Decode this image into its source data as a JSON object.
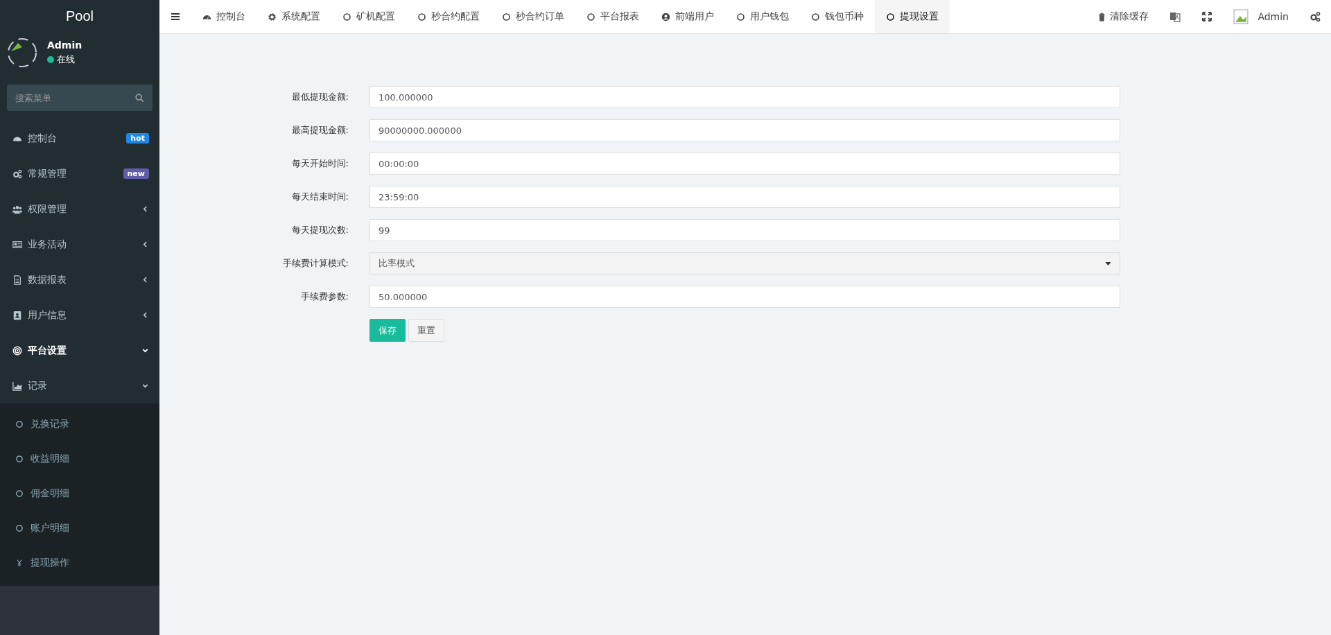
{
  "sidebar": {
    "title": "Pool",
    "user": {
      "name": "Admin",
      "status": "在线"
    },
    "search": {
      "placeholder": "搜索菜单"
    },
    "menu": [
      {
        "label": "控制台",
        "kind": "dashboard",
        "badge": {
          "text": "hot",
          "color": "#1e88e5"
        },
        "selected": false
      },
      {
        "label": "常规管理",
        "kind": "gears",
        "badge": {
          "text": "new",
          "color": "#605ca8"
        },
        "selected": false
      },
      {
        "label": "权限管理",
        "kind": "users",
        "expanded": false,
        "selected": false
      },
      {
        "label": "业务活动",
        "kind": "newspaper",
        "expanded": false,
        "selected": false
      },
      {
        "label": "数据报表",
        "kind": "file",
        "expanded": false,
        "selected": false
      },
      {
        "label": "用户信息",
        "kind": "contact",
        "expanded": false,
        "selected": false
      },
      {
        "label": "平台设置",
        "kind": "target",
        "expanded": true,
        "selected": true
      },
      {
        "label": "记录",
        "kind": "chart",
        "expanded": true,
        "selected": false,
        "children": [
          {
            "label": "兑换记录",
            "kind": "circle"
          },
          {
            "label": "收益明细",
            "kind": "circle"
          },
          {
            "label": "佣金明细",
            "kind": "circle"
          },
          {
            "label": "账户明细",
            "kind": "circle"
          },
          {
            "label": "提现操作",
            "kind": "yen"
          }
        ]
      }
    ]
  },
  "tabs": [
    {
      "label": "控制台",
      "kind": "dashboard",
      "selected": false
    },
    {
      "label": "系统配置",
      "kind": "gear",
      "selected": false
    },
    {
      "label": "矿机配置",
      "kind": "circle",
      "selected": false
    },
    {
      "label": "秒合约配置",
      "kind": "circle",
      "selected": false
    },
    {
      "label": "秒合约订单",
      "kind": "circle",
      "selected": false
    },
    {
      "label": "平台报表",
      "kind": "circle",
      "selected": false
    },
    {
      "label": "前端用户",
      "kind": "user",
      "selected": false
    },
    {
      "label": "用户钱包",
      "kind": "circle",
      "selected": false
    },
    {
      "label": "钱包币种",
      "kind": "circle",
      "selected": false
    },
    {
      "label": "提现设置",
      "kind": "circle",
      "selected": true
    }
  ],
  "toolbar": {
    "clear_cache": "清除缓存",
    "user": "Admin"
  },
  "form": {
    "fields": [
      {
        "label": "最低提现金额:",
        "kind": "input",
        "value": "100.000000"
      },
      {
        "label": "最高提现金额:",
        "kind": "input",
        "value": "90000000.000000"
      },
      {
        "label": "每天开始时间:",
        "kind": "input",
        "value": "00:00:00"
      },
      {
        "label": "每天结束时间:",
        "kind": "input",
        "value": "23:59:00"
      },
      {
        "label": "每天提现次数:",
        "kind": "input",
        "value": "99"
      },
      {
        "label": "手续费计算模式:",
        "kind": "select",
        "value": "比率模式"
      },
      {
        "label": "手续费参数:",
        "kind": "input",
        "value": "50.000000"
      }
    ],
    "buttons": [
      {
        "label": "保存",
        "kind": "primary"
      },
      {
        "label": "重置",
        "kind": "default"
      }
    ]
  }
}
